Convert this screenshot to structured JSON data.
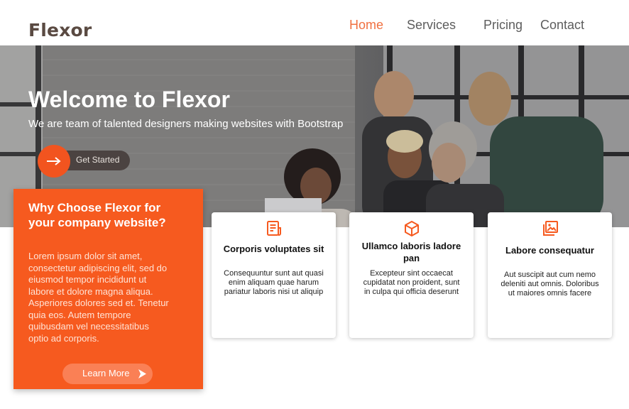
{
  "brand": {
    "name": "Flexor"
  },
  "nav": {
    "items": [
      {
        "label": "Home",
        "active": true
      },
      {
        "label": "Services",
        "active": false
      },
      {
        "label": "Pricing",
        "active": false
      },
      {
        "label": "Contact",
        "active": false
      }
    ]
  },
  "hero": {
    "title": "Welcome to Flexor",
    "subtitle": "We are team of talented designers making websites with Bootstrap",
    "cta_label": "Get Started",
    "cta_icon": "arrow-right-icon"
  },
  "why": {
    "title": "Why Choose Flexor for your company website?",
    "text": "Lorem ipsum dolor sit amet, consectetur adipiscing elit, sed do eiusmod tempor incididunt ut labore et dolore magna aliqua. Asperiores dolores sed et. Tenetur quia eos. Autem tempore quibusdam vel necessitatibus optio ad corporis.",
    "button_label": "Learn More",
    "button_icon": "play-chevron-icon"
  },
  "cards": [
    {
      "icon": "receipt-icon",
      "title": "Corporis voluptates sit",
      "text": "Consequuntur sunt aut quasi enim aliquam quae harum pariatur laboris nisi ut aliquip"
    },
    {
      "icon": "cube-icon",
      "title": "Ullamco laboris ladore pan",
      "text": "Excepteur sint occaecat cupidatat non proident, sunt in culpa qui officia deserunt"
    },
    {
      "icon": "images-icon",
      "title": "Labore consequatur",
      "text": "Aut suscipit aut cum nemo deleniti aut omnis. Doloribus ut maiores omnis facere"
    }
  ],
  "colors": {
    "accent": "#f65a1f",
    "nav_active": "#f07040",
    "logo": "#5a4a42"
  }
}
